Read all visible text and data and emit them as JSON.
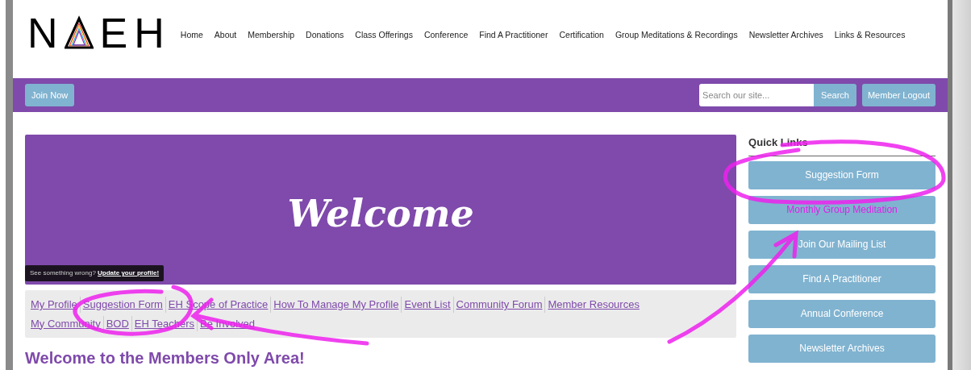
{
  "logo": {
    "before": "N",
    "after": "EH"
  },
  "nav": [
    "Home",
    "About",
    "Membership",
    "Donations",
    "Class Offerings",
    "Conference",
    "Find A Practitioner",
    "Certification",
    "Group Meditations & Recordings",
    "Newsletter Archives",
    "Links & Resources"
  ],
  "toolbar": {
    "join_button": "Join Now",
    "search": {
      "placeholder": "Search our site...",
      "button": "Search"
    },
    "logout_button": "Member Logout"
  },
  "banner": {
    "title": "Welcome",
    "notice": "See something wrong?",
    "notice_link": "Update your profile!"
  },
  "member_links": [
    [
      "My Profile",
      "Suggestion Form",
      "EH Scope of Practice",
      "How To Manage My Profile",
      "Event List",
      "Community Forum",
      "Member Resources"
    ],
    [
      "My Community",
      "BOD",
      "EH Teachers",
      "Be Involved"
    ]
  ],
  "heading": "Welcome to the Members Only Area!",
  "quick_links": {
    "title": "Quick Links",
    "items": [
      {
        "label": "Suggestion Form",
        "hovered": false
      },
      {
        "label": "Monthly Group Meditation",
        "hovered": true
      },
      {
        "label": "Join Our Mailing List",
        "hovered": false
      },
      {
        "label": "Find A Practitioner",
        "hovered": false
      },
      {
        "label": "Annual Conference",
        "hovered": false
      },
      {
        "label": "Newsletter Archives",
        "hovered": false
      }
    ]
  }
}
